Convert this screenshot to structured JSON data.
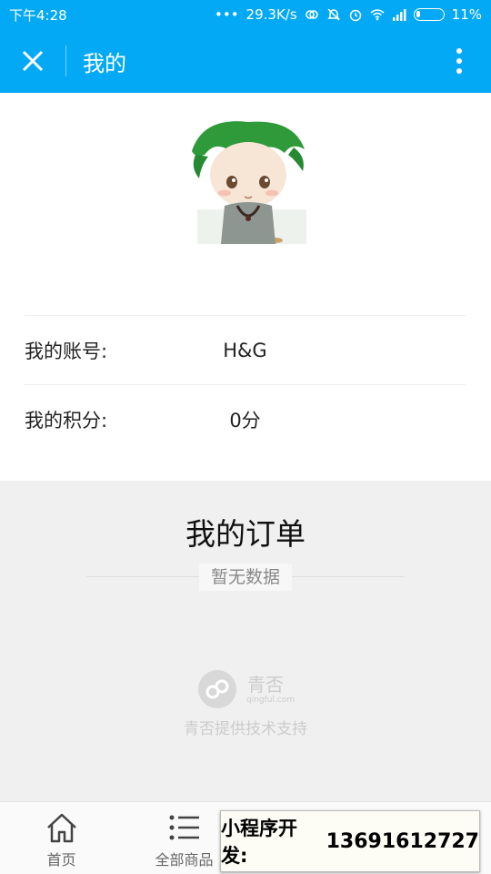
{
  "status_bar": {
    "time": "下午4:28",
    "dots": "•••",
    "network_speed": "29.3K/s",
    "battery_percent": "11%"
  },
  "title_bar": {
    "title": "我的",
    "close_icon": "close-icon",
    "more_icon": "more-vertical-icon",
    "background": "#03a9f4"
  },
  "profile": {
    "account_label": "我的账号:",
    "account_value": "H&G",
    "points_label": "我的积分:",
    "points_value": "0分"
  },
  "orders": {
    "title": "我的订单",
    "empty_text": "暂无数据"
  },
  "brand": {
    "name": "青否",
    "url": "qingful.com",
    "support": "青否提供技术支持"
  },
  "tabs": [
    {
      "label": "首页",
      "icon": "home-icon"
    },
    {
      "label": "全部商品",
      "icon": "list-icon"
    }
  ],
  "promo": {
    "label": "小程序开发:",
    "number": "13691612727"
  }
}
